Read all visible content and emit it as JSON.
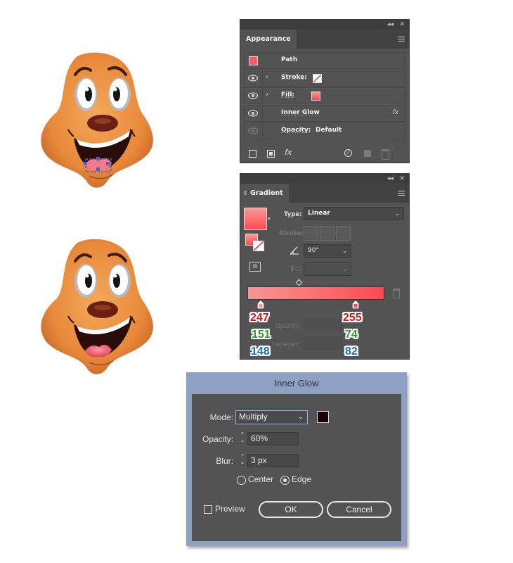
{
  "appearance_panel": {
    "tab_label": "Appearance",
    "rows": {
      "path": {
        "label": "Path"
      },
      "stroke": {
        "label": "Stroke:"
      },
      "fill": {
        "label": "Fill:"
      },
      "inner_glow": {
        "label": "Inner Glow",
        "fx": "fx"
      },
      "opacity": {
        "label": "Opacity:",
        "value": "Default"
      }
    },
    "footer_fx": "fx"
  },
  "gradient_panel": {
    "tab_label": "Gradient",
    "type_label": "Type:",
    "type_value": "Linear",
    "stroke_label": "Stroke:",
    "angle_value": "90°",
    "opacity_label": "Opacity:",
    "location_label": "Location:",
    "gradient_colors": {
      "left": "#f79794",
      "right": "#ff4a52"
    },
    "left_stop_rgb": {
      "r": "247",
      "g": "151",
      "b": "148"
    },
    "right_stop_rgb": {
      "r": "255",
      "g": "74",
      "b": "82"
    }
  },
  "inner_glow_dialog": {
    "title": "Inner Glow",
    "mode_label": "Mode:",
    "mode_value": "Multiply",
    "glow_color": "#1a0008",
    "opacity_label": "Opacity:",
    "opacity_value": "60%",
    "blur_label": "Blur:",
    "blur_value": "3 px",
    "center_label": "Center",
    "edge_label": "Edge",
    "selected_option": "Edge",
    "preview_label": "Preview",
    "preview_checked": false,
    "ok_label": "OK",
    "cancel_label": "Cancel"
  },
  "colors": {
    "panel_bg": "#535353",
    "rgb_red": "#cc1a1a",
    "rgb_green": "#2e9a2e",
    "rgb_blue": "#1c6fbf",
    "face_orange": "#e88a38",
    "selection_blue": "#4b5fd6"
  }
}
